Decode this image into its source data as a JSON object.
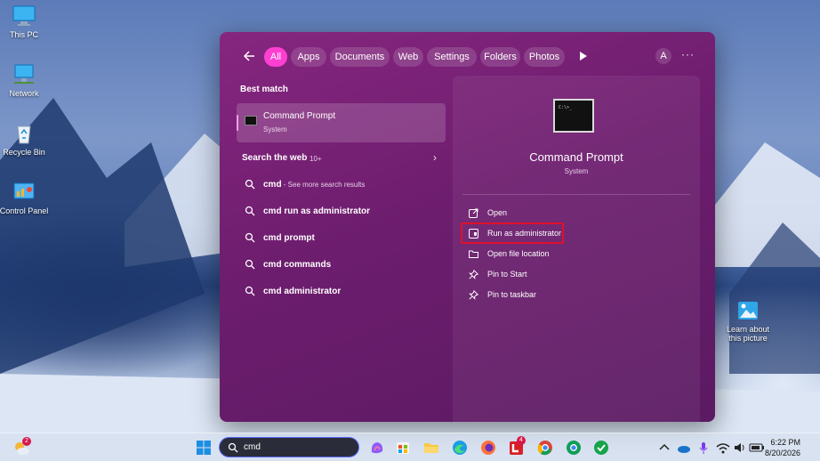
{
  "desktop": {
    "icons": [
      {
        "label": "This PC"
      },
      {
        "label": "Network"
      },
      {
        "label": "Recycle Bin"
      },
      {
        "label": "Control Panel"
      }
    ],
    "learn_about": "Learn about this picture"
  },
  "start_menu": {
    "filters": [
      "All",
      "Apps",
      "Documents",
      "Web",
      "Settings",
      "Folders",
      "Photos"
    ],
    "active_filter": "All",
    "avatar_letter": "A",
    "more_label": "···",
    "best_match_title": "Best match",
    "best_match": {
      "name": "Command Prompt",
      "type": "System"
    },
    "search_web_title": "Search the web",
    "search_web_count": "10+",
    "web_results": [
      {
        "term": "cmd",
        "suffix": " - See more search results"
      },
      {
        "term": "cmd run as administrator",
        "suffix": ""
      },
      {
        "term": "cmd prompt",
        "suffix": ""
      },
      {
        "term": "cmd commands",
        "suffix": ""
      },
      {
        "term": "cmd administrator",
        "suffix": ""
      }
    ],
    "detail": {
      "app_name": "Command Prompt",
      "app_type": "System",
      "actions": [
        "Open",
        "Run as administrator",
        "Open file location",
        "Pin to Start",
        "Pin to taskbar"
      ]
    }
  },
  "taskbar": {
    "search_value": "cmd",
    "widgets_badge": "2",
    "app_badge": "4",
    "time": "6:22 PM",
    "date": "8/20/2026"
  },
  "colors": {
    "menu_bg": "#6d1d6e",
    "active_chip": "#ff3fd1",
    "highlight_box": "#e0102b"
  }
}
